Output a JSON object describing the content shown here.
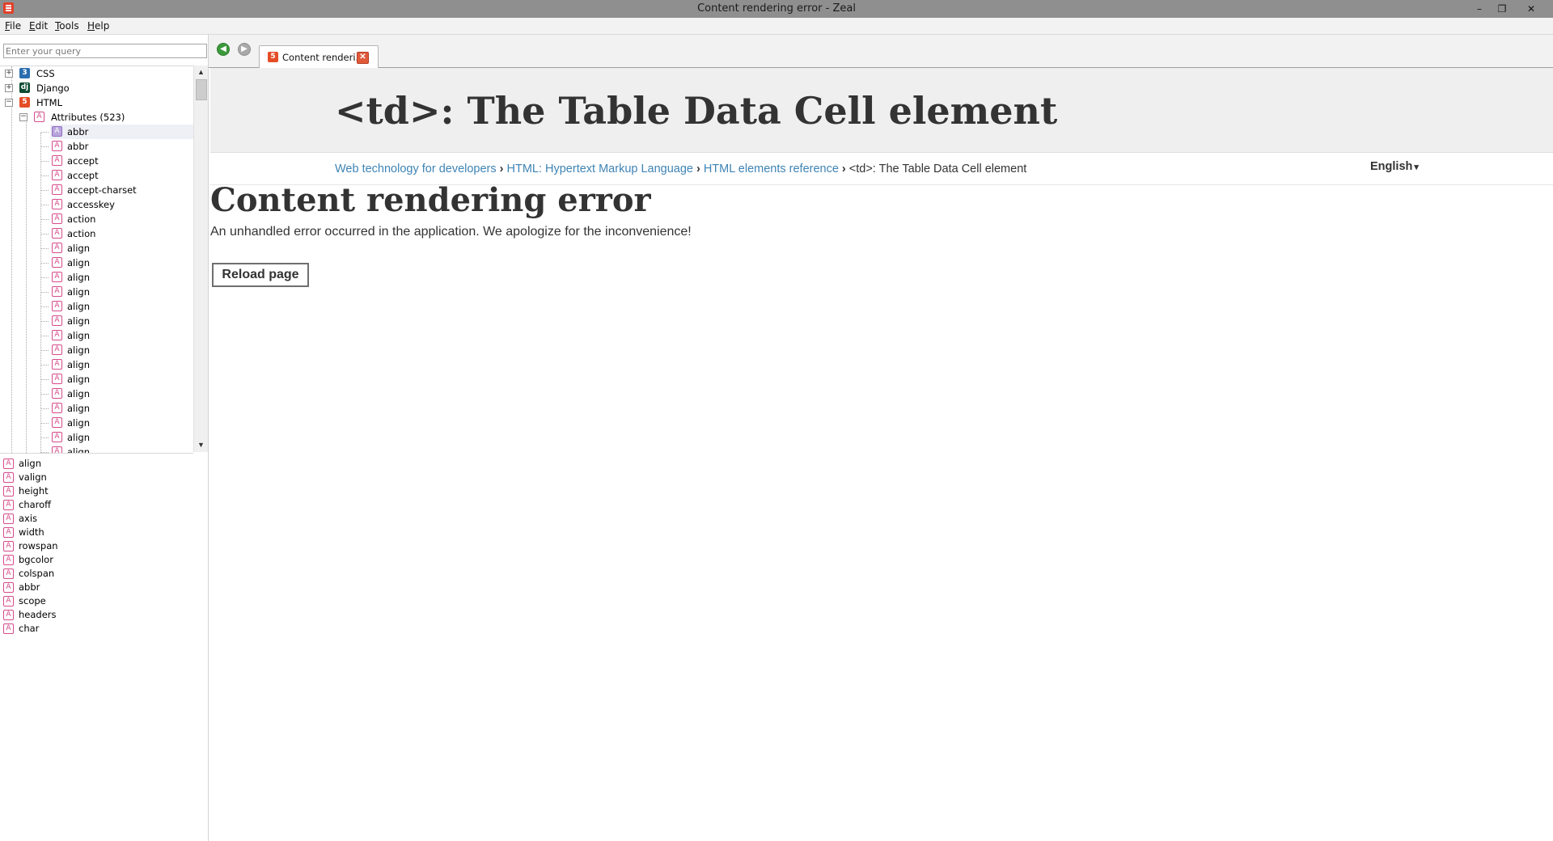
{
  "window": {
    "title": "Content rendering error - Zeal",
    "controls": {
      "minimize": "–",
      "restore": "❐",
      "close": "✕"
    }
  },
  "menu": [
    {
      "label": "File",
      "accel": "F",
      "rest": "ile"
    },
    {
      "label": "Edit",
      "accel": "E",
      "rest": "dit"
    },
    {
      "label": "Tools",
      "accel": "T",
      "rest": "ools"
    },
    {
      "label": "Help",
      "accel": "H",
      "rest": "elp"
    }
  ],
  "search": {
    "placeholder": "Enter your query",
    "value": ""
  },
  "tree": {
    "docsets": [
      {
        "label": "CSS",
        "icon": "css3-icon",
        "glyph": "3",
        "expander": "+"
      },
      {
        "label": "Django",
        "icon": "django-icon",
        "glyph": "dj",
        "expander": "+"
      },
      {
        "label": "HTML",
        "icon": "html5-icon",
        "glyph": "5",
        "expander": "−"
      }
    ],
    "group": {
      "label": "Attributes (523)",
      "expander": "−"
    },
    "items": [
      "abbr",
      "abbr",
      "accept",
      "accept",
      "accept-charset",
      "accesskey",
      "action",
      "action",
      "align",
      "align",
      "align",
      "align",
      "align",
      "align",
      "align",
      "align",
      "align",
      "align",
      "align",
      "align",
      "align",
      "align",
      "align"
    ],
    "selected_index": 0
  },
  "scrollbar": {
    "up": "▲",
    "down": "▼"
  },
  "attribute_list": [
    "align",
    "valign",
    "height",
    "charoff",
    "axis",
    "width",
    "rowspan",
    "bgcolor",
    "colspan",
    "abbr",
    "scope",
    "headers",
    "char"
  ],
  "attr_glyph": "A",
  "toolbar": {
    "back": "◀",
    "forward": "▶"
  },
  "tab": {
    "label": "Content renderi...",
    "close": "✕",
    "icon": "html5-icon",
    "glyph": "5"
  },
  "page": {
    "doc_title": "<td>: The Table Data Cell element",
    "breadcrumbs": [
      "Web technology for developers",
      "HTML: Hypertext Markup Language",
      "HTML elements reference"
    ],
    "breadcrumb_sep": "›",
    "breadcrumb_current": "<td>: The Table Data Cell element",
    "language": "English",
    "language_caret": "▾",
    "error_title": "Content rendering error",
    "error_text": "An unhandled error occurred in the application. We apologize for the inconvenience!",
    "reload_label": "Reload page"
  },
  "colors": {
    "titlebar": "#8f8f8f",
    "link": "#3e84b5",
    "attr_icon": "#d64b8b",
    "html_icon": "#e44d26"
  }
}
